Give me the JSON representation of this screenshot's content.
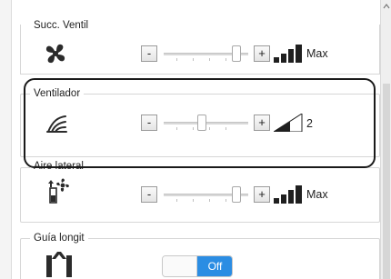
{
  "groups": {
    "succ_ventil": {
      "title": "Succ. Ventil",
      "minus": "-",
      "plus": "+",
      "level": "Max",
      "slider_fraction": 0.9
    },
    "ventilador": {
      "title": "Ventilador",
      "minus": "-",
      "plus": "+",
      "level": "2",
      "slider_fraction": 0.45
    },
    "aire_lateral": {
      "title": "Aire lateral",
      "minus": "-",
      "plus": "+",
      "level": "Max",
      "slider_fraction": 0.9
    },
    "guia_longit": {
      "title": "Guía longit",
      "toggle": "Off"
    }
  },
  "colors": {
    "accent": "#2b8de3",
    "highlight_border": "#1a1a1a",
    "level_bars": "#1f1f1f"
  },
  "icons": [
    "fan-icon",
    "fan-airflow-icon",
    "side-air-icon",
    "guide-icon",
    "level-bars-icon"
  ]
}
